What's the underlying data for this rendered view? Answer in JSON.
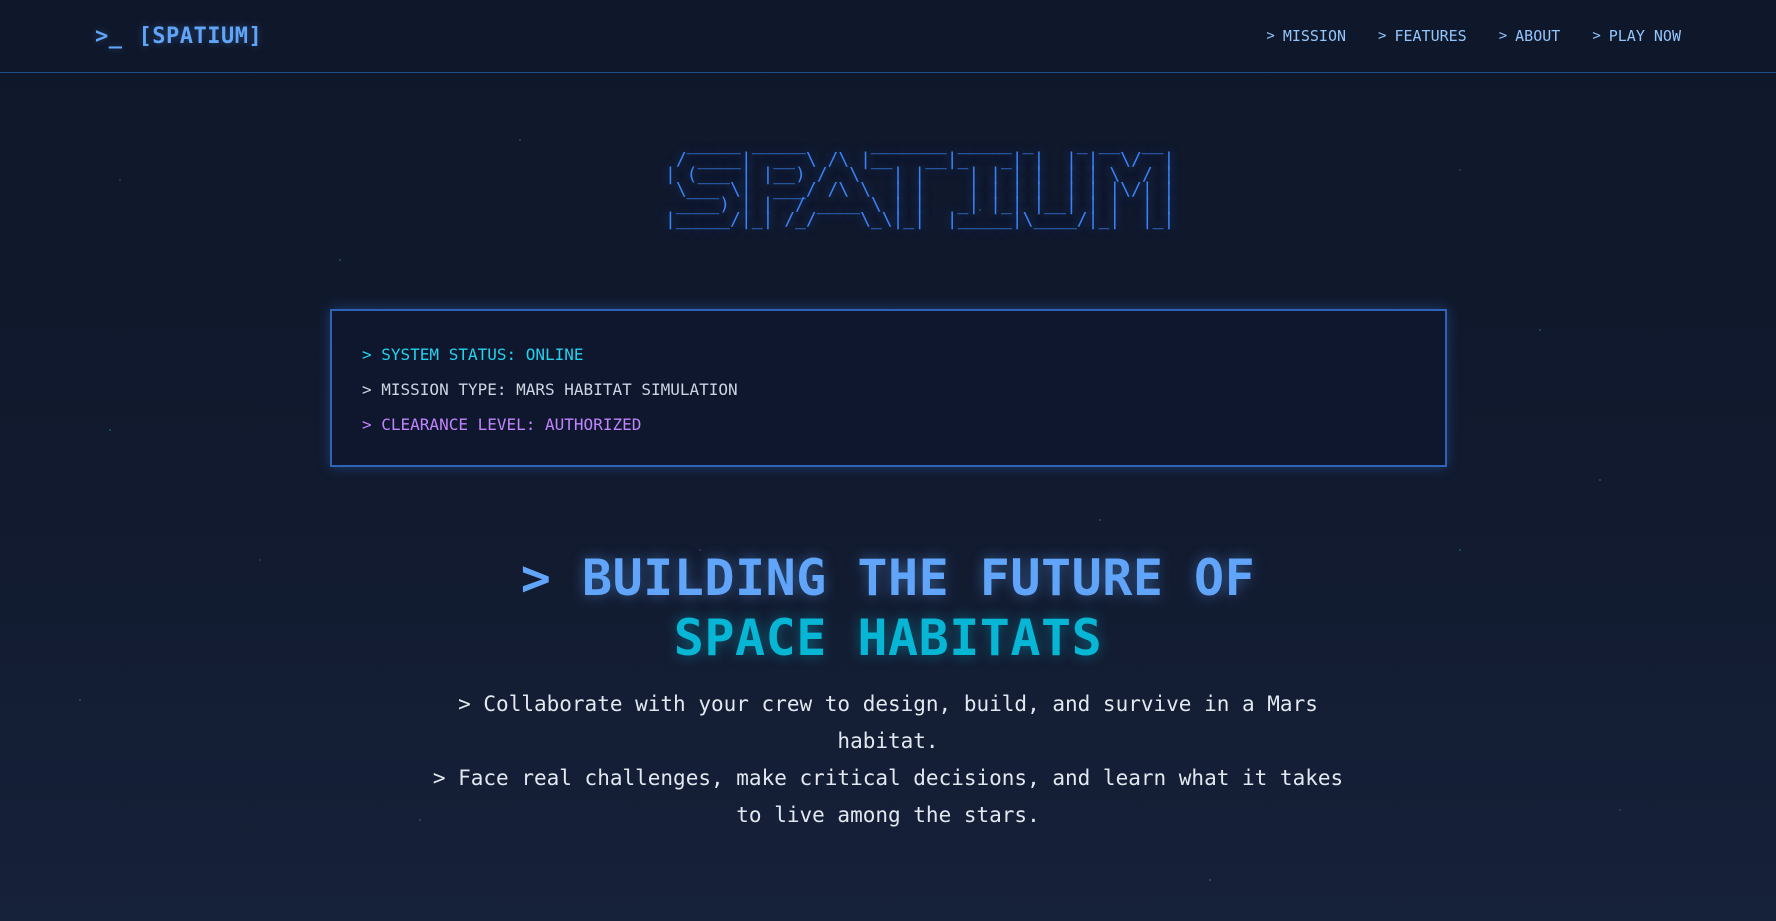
{
  "brand": {
    "icon": "terminal-prompt-icon",
    "name": "[SPATIUM]"
  },
  "nav": [
    {
      "label": "MISSION"
    },
    {
      "label": "FEATURES"
    },
    {
      "label": "ABOUT"
    },
    {
      "label": "PLAY NOW"
    }
  ],
  "hero": {
    "ascii_logo": "  _____ _____      _______ _____ _    _ __  __ \n / ____|  __ \\ /\\ |__   __|_   _| |  | |  \\/  |\n| (___ | |__) /  \\   | |    | | | |  | | \\  / |\n \\___ \\|  ___/ /\\ \\  | |    | | | |  | | |\\/| |\n ____) | |  / ____ \\ | |   _| |_| |__| | |  | |\n|_____/|_| /_/    \\_\\|_|  |_____|\\____/|_|  |_|"
  },
  "status": {
    "line1": "> SYSTEM STATUS: ONLINE",
    "line2": "> MISSION TYPE: MARS HABITAT SIMULATION",
    "line3": "> CLEARANCE LEVEL: AUTHORIZED"
  },
  "headline": {
    "prefix": ">",
    "line1": "BUILDING THE FUTURE OF",
    "line2": "SPACE HABITATS"
  },
  "description": [
    "> Collaborate with your crew to design, build, and survive in a Mars habitat.",
    "> Face real challenges, make critical decisions, and learn what it takes to live among the stars."
  ],
  "colors": {
    "background": "#0f172a",
    "accent_blue": "#60a5fa",
    "accent_cyan": "#06b6d4",
    "accent_purple": "#c084fc",
    "border_blue": "#2f63b6"
  }
}
